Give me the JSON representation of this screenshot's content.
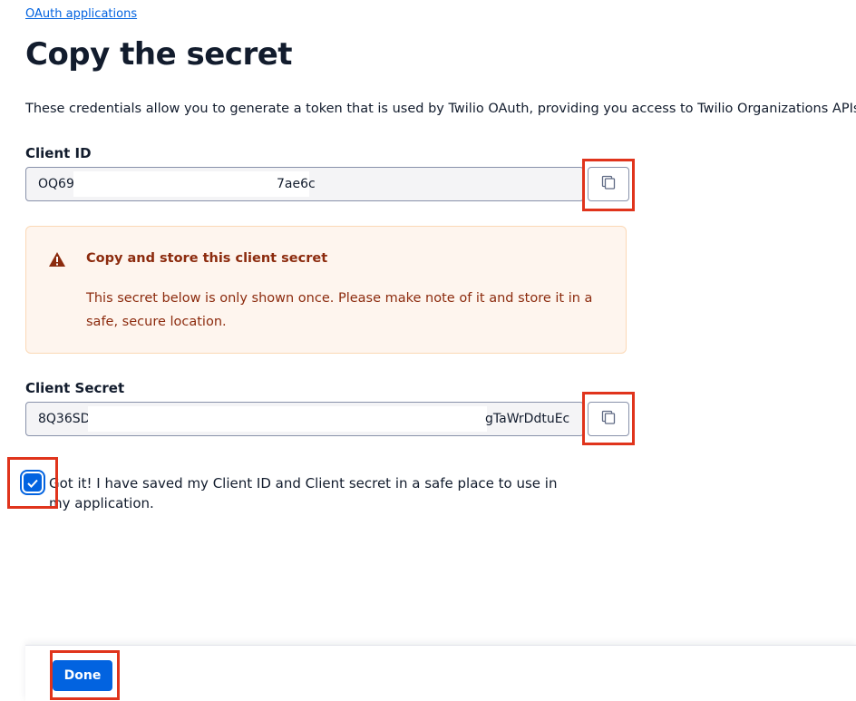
{
  "breadcrumb": {
    "label": "OAuth applications"
  },
  "page": {
    "title": "Copy the secret",
    "description": "These credentials allow you to generate a token that is used by Twilio OAuth, providing you access to Twilio Organizations APIs."
  },
  "client_id": {
    "label": "Client ID",
    "value_start": "OQ69",
    "value_end": "7ae6c",
    "copy_icon": "copy-icon"
  },
  "warning": {
    "icon": "warning-triangle-icon",
    "title": "Copy and store this client secret",
    "body": "This secret below is only shown once. Please make note of it and store it in a safe, secure location."
  },
  "client_secret": {
    "label": "Client Secret",
    "value_start": "8Q36SD",
    "value_end": "gTaWrDdtuEc",
    "copy_icon": "copy-icon"
  },
  "confirm": {
    "checked": true,
    "label": "Got it! I have saved my Client ID and Client secret in a safe place to use in my application."
  },
  "footer": {
    "done_label": "Done"
  },
  "colors": {
    "primary": "#0263e0",
    "highlight": "#e0341c",
    "warning_text": "#8c2b0e",
    "warning_bg": "#fef5ee"
  }
}
